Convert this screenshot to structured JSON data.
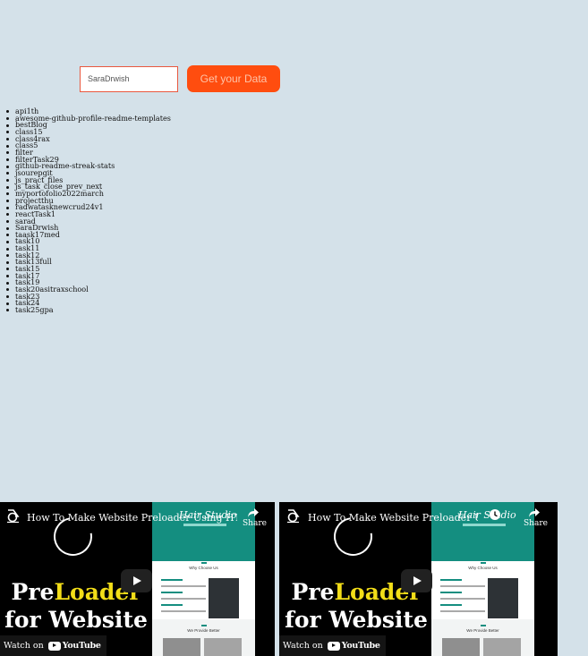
{
  "search": {
    "value": "SaraDrwish",
    "button_label": "Get your Data"
  },
  "repos": [
    "api1th",
    "awesome-github-profile-readme-templates",
    "bestBlog",
    "class15",
    "class4rax",
    "class5",
    "filter",
    "filterTask29",
    "github-readme-streak-stats",
    "jsourepgit",
    "js_pract_files",
    "js_task_close_prev_next",
    "myportofolio2022march",
    "projectthu",
    "radwatasknewcrud24v1",
    "reactTask1",
    "sarad",
    "SaraDrwish",
    "taask17med",
    "task10",
    "task11",
    "task12",
    "task13full",
    "task15",
    "task17",
    "task19",
    "task20asitraxschool",
    "task23",
    "task24",
    "task25gpa"
  ],
  "videos": [
    {
      "title": "How To Make Website Preloader Using HTML CSS ...",
      "share_label": "Share",
      "watch_on": "Watch on",
      "youtube": "YouTube",
      "preloader_pre": "Pre",
      "preloader_loader": "Loader",
      "preloader_line2": "for Website",
      "thumb_brand": "Hair Studio",
      "thumb_section1": "Why Choose Us",
      "thumb_section2": "We Provide Better"
    },
    {
      "title": "How To Make Website Preloader Using ...",
      "share_label": "Share",
      "watch_on": "Watch on",
      "youtube": "YouTube",
      "preloader_pre": "Pre",
      "preloader_loader": "Loader",
      "preloader_line2": "for Website",
      "thumb_brand": "Hair Studio",
      "thumb_section1": "Why Choose Us",
      "thumb_section2": "We Provide Better"
    }
  ],
  "colors": {
    "background": "#d4e1e9",
    "button": "#ff4d0f",
    "input_border": "#e9583f",
    "thumb_teal": "#148e80",
    "preloader_accent": "#f2dd18"
  }
}
